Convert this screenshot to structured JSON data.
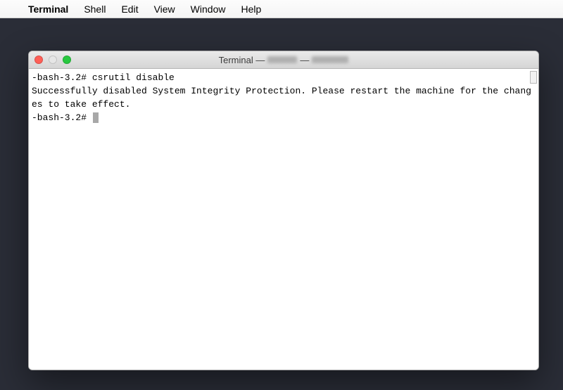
{
  "menubar": {
    "app": "Terminal",
    "items": [
      "Shell",
      "Edit",
      "View",
      "Window",
      "Help"
    ]
  },
  "window": {
    "title_prefix": "Terminal —",
    "lights": {
      "close": "close",
      "minimize": "minimize",
      "zoom": "zoom"
    }
  },
  "terminal": {
    "line1_prompt": "-bash-3.2#",
    "line1_cmd": "csrutil disable",
    "output": "Successfully disabled System Integrity Protection. Please restart the machine for the changes to take effect.",
    "line3_prompt": "-bash-3.2#"
  }
}
